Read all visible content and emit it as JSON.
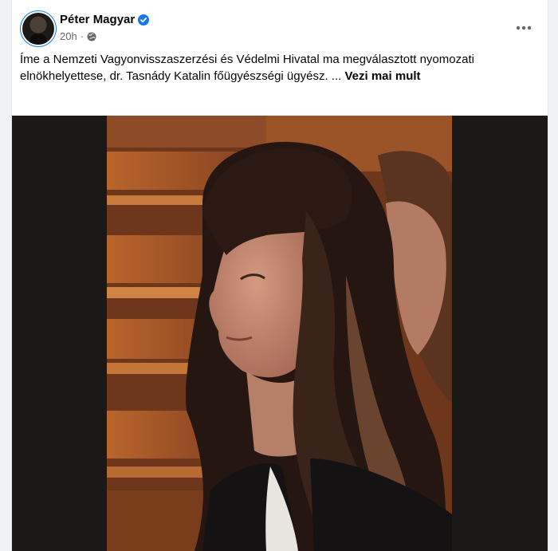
{
  "post": {
    "author": "Péter Magyar",
    "time": "20h",
    "separator": "·",
    "text": "Íme a Nemzeti Vagyonvisszaszerzési és Védelmi Hivatal ma megválasztott nyomozati elnökhelyettese, dr. Tasnády Katalin főügyészségi ügyész. ...",
    "see_more_label": "Vezi mai mult",
    "icons": {
      "verified": "verified-badge-icon",
      "audience": "globe-icon",
      "more": "more-options-icon"
    },
    "colors": {
      "accent": "#1877f2",
      "secondary_text": "#65676b"
    }
  }
}
